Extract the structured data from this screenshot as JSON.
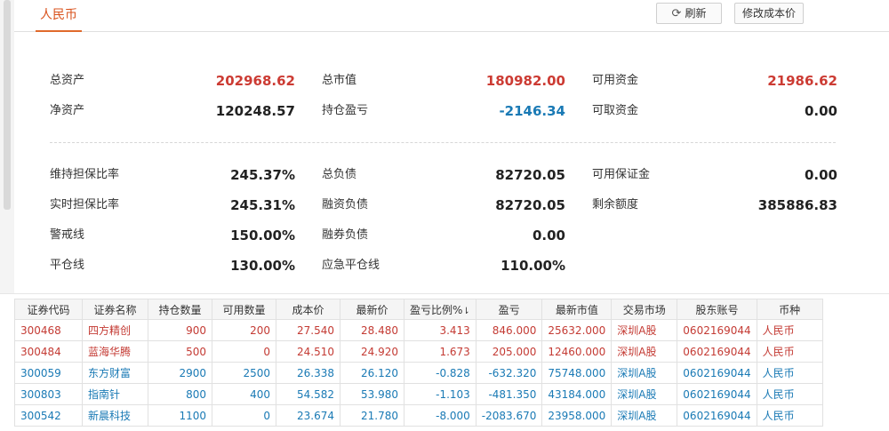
{
  "tabs": {
    "currency": "人民币"
  },
  "toolbar": {
    "refresh_label": "刷新",
    "modify_cost_label": "修改成本价"
  },
  "summary": {
    "total_assets_label": "总资产",
    "total_assets_value": "202968.62",
    "total_market_value_label": "总市值",
    "total_market_value_value": "180982.00",
    "available_funds_label": "可用资金",
    "available_funds_value": "21986.62",
    "net_assets_label": "净资产",
    "net_assets_value": "120248.57",
    "position_pnl_label": "持仓盈亏",
    "position_pnl_value": "-2146.34",
    "withdrawable_funds_label": "可取资金",
    "withdrawable_funds_value": "0.00",
    "maintenance_ratio_label": "维持担保比率",
    "maintenance_ratio_value": "245.37%",
    "total_liabilities_label": "总负债",
    "total_liabilities_value": "82720.05",
    "available_margin_label": "可用保证金",
    "available_margin_value": "0.00",
    "realtime_ratio_label": "实时担保比率",
    "realtime_ratio_value": "245.31%",
    "financing_liabilities_label": "融资负债",
    "financing_liabilities_value": "82720.05",
    "remaining_quota_label": "剩余额度",
    "remaining_quota_value": "385886.83",
    "warning_line_label": "警戒线",
    "warning_line_value": "150.00%",
    "securities_liabilities_label": "融券负债",
    "securities_liabilities_value": "0.00",
    "liquidation_line_label": "平仓线",
    "liquidation_line_value": "130.00%",
    "emergency_liquidation_label": "应急平仓线",
    "emergency_liquidation_value": "110.00%"
  },
  "colors": {
    "up": "#c43b34",
    "down": "#1a7ab5",
    "accent": "#e06a2c"
  },
  "table": {
    "headers": [
      "证券代码",
      "证券名称",
      "持仓数量",
      "可用数量",
      "成本价",
      "最新价",
      "盈亏比例%",
      "盈亏",
      "最新市值",
      "交易市场",
      "股东账号",
      "币种"
    ],
    "sort_icon": "sort-down-arrow-icon",
    "sort_glyph": "⇂",
    "rows": [
      {
        "trend": "up",
        "cells": [
          "300468",
          "四方精创",
          "900",
          "200",
          "27.540",
          "28.480",
          "3.413",
          "846.000",
          "25632.000",
          "深圳A股",
          "0602169044",
          "人民币"
        ]
      },
      {
        "trend": "up",
        "cells": [
          "300484",
          "蓝海华腾",
          "500",
          "0",
          "24.510",
          "24.920",
          "1.673",
          "205.000",
          "12460.000",
          "深圳A股",
          "0602169044",
          "人民币"
        ]
      },
      {
        "trend": "down",
        "cells": [
          "300059",
          "东方财富",
          "2900",
          "2500",
          "26.338",
          "26.120",
          "-0.828",
          "-632.320",
          "75748.000",
          "深圳A股",
          "0602169044",
          "人民币"
        ]
      },
      {
        "trend": "down",
        "cells": [
          "300803",
          "指南针",
          "800",
          "400",
          "54.582",
          "53.980",
          "-1.103",
          "-481.350",
          "43184.000",
          "深圳A股",
          "0602169044",
          "人民币"
        ]
      },
      {
        "trend": "down",
        "cells": [
          "300542",
          "新晨科技",
          "1100",
          "0",
          "23.674",
          "21.780",
          "-8.000",
          "-2083.670",
          "23958.000",
          "深圳A股",
          "0602169044",
          "人民币"
        ]
      }
    ]
  }
}
